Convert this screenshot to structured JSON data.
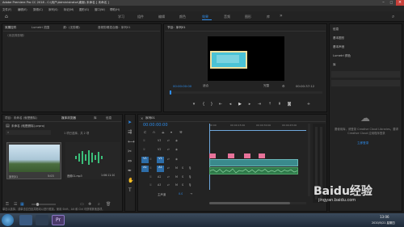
{
  "titlebar": {
    "title": "Adobe Premiere Pro CC 2018 - C:\\用户\\Administrator\\桌面\\ 未命名 [ 未命名 ]"
  },
  "menu": [
    "文件(F)",
    "编辑(E)",
    "剪辑(C)",
    "序列(S)",
    "标记(M)",
    "图形(G)",
    "窗口(W)",
    "帮助(H)"
  ],
  "workspaces": [
    "学习",
    "组件",
    "编辑",
    "颜色",
    "效果",
    "音频",
    "图形",
    "库"
  ],
  "workspace_active": 4,
  "source_panel": {
    "tabs": [
      "效果控件",
      "Lumetri 范围",
      "源：(无剪辑)",
      "音频剪辑混合器：序列01"
    ],
    "empty_text": "（未选择剪辑）"
  },
  "program_panel": {
    "tab": "节目：序列01",
    "timecode_left": "00:00:00:00",
    "fit": "适合",
    "quality": "完整",
    "timecode_right": "00:00:37:12"
  },
  "right_panel": {
    "items": [
      "信息",
      "基本图形",
      "基本声音",
      "Lumetri 颜色",
      "库"
    ],
    "cc_text": "要使用库，请登录 Creative Cloud Libraries。要求 Creative Cloud 应用程序登录",
    "cc_link": "立即登录"
  },
  "project_panel": {
    "tabs": [
      "项目：未命名 (就是删除)",
      "媒体浏览器",
      "库",
      "信息",
      "效果",
      "标记"
    ],
    "path": "未命名 (就是删除).prproj",
    "count": "1 项已选择，共 2 项",
    "items": [
      {
        "name": "序列01",
        "duration": "5:03"
      },
      {
        "name": "音频01.mp3",
        "duration": "1:06:11:10"
      }
    ]
  },
  "timeline": {
    "tab": "序列01",
    "timecode": "00:00:00:00",
    "ruler": [
      "00:00",
      "00:00:15:00",
      "00:00:30:00",
      "00:00:45:00"
    ],
    "video_tracks": [
      "V3",
      "V2",
      "V1"
    ],
    "audio_tracks": [
      "A1",
      "A2",
      "A3"
    ],
    "master": "主声道",
    "master_value": "0.0"
  },
  "status": {
    "text": "单击以选择，或单击空白处并拖动以进行框选。使用 Shift、Alt 和 Ctrl 可获得其他选项。"
  },
  "taskbar": {
    "time": "13:06",
    "date": "2020/5/21 星期四"
  },
  "watermark": {
    "text": "Baidu经验",
    "sub": "jingyan.baidu.com"
  },
  "colors": {
    "accent": "#2d8ceb",
    "clip_pink": "#e8739a",
    "clip_teal": "#3a8a8c",
    "clip_audio": "#2f7a4a",
    "timeline_blue": "#6fa8dc"
  }
}
